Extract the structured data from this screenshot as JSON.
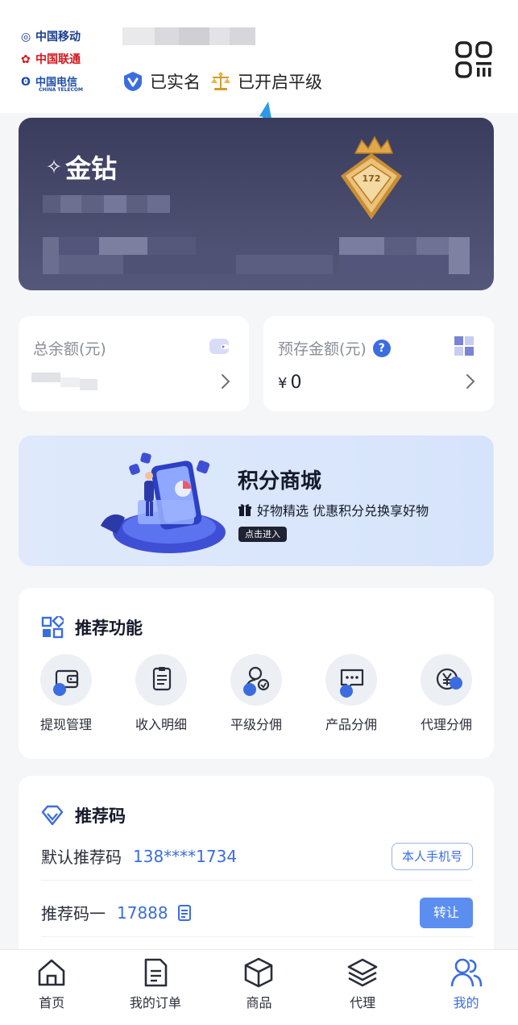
{
  "header": {
    "carriers": [
      {
        "name": "中国移动",
        "icon": "china-mobile-logo"
      },
      {
        "name": "中国联通",
        "icon": "china-unicom-logo"
      },
      {
        "name": "中国电信",
        "subtitle": "CHINA TELECOM",
        "icon": "china-telecom-logo"
      }
    ],
    "verified_label": "已实名",
    "peer_level_label": "已开启平级",
    "qr_icon": "qr-code-icon"
  },
  "member_card": {
    "level_name": "金钻",
    "badge_number": "172"
  },
  "balances": {
    "total": {
      "title": "总余额(元)"
    },
    "prepaid": {
      "title": "预存金额(元)",
      "help": "?",
      "value": "0",
      "currency": "¥"
    }
  },
  "banner": {
    "title": "积分商城",
    "subtitle": "好物精选 优惠积分兑换享好物",
    "button": "点击进入"
  },
  "functions": {
    "title": "推荐功能",
    "items": [
      {
        "label": "提现管理",
        "icon": "wallet-icon"
      },
      {
        "label": "收入明细",
        "icon": "clipboard-icon"
      },
      {
        "label": "平级分佣",
        "icon": "user-share-icon"
      },
      {
        "label": "产品分佣",
        "icon": "chat-icon"
      },
      {
        "label": "代理分佣",
        "icon": "yen-icon"
      }
    ]
  },
  "referral": {
    "title": "推荐码",
    "default_label": "默认推荐码",
    "default_value": "138****1734",
    "phone_button": "本人手机号",
    "code1_label": "推荐码一",
    "code1_value": "17888",
    "transfer_button": "转让"
  },
  "nav": {
    "items": [
      {
        "label": "首页",
        "icon": "home-icon"
      },
      {
        "label": "我的订单",
        "icon": "order-icon"
      },
      {
        "label": "商品",
        "icon": "box-icon"
      },
      {
        "label": "代理",
        "icon": "layers-icon"
      },
      {
        "label": "我的",
        "icon": "users-icon",
        "active": true
      }
    ]
  },
  "colors": {
    "accent": "#3b6de0",
    "card_dark": "#3a3c5e",
    "banner_bg": "#dfe9fb"
  }
}
